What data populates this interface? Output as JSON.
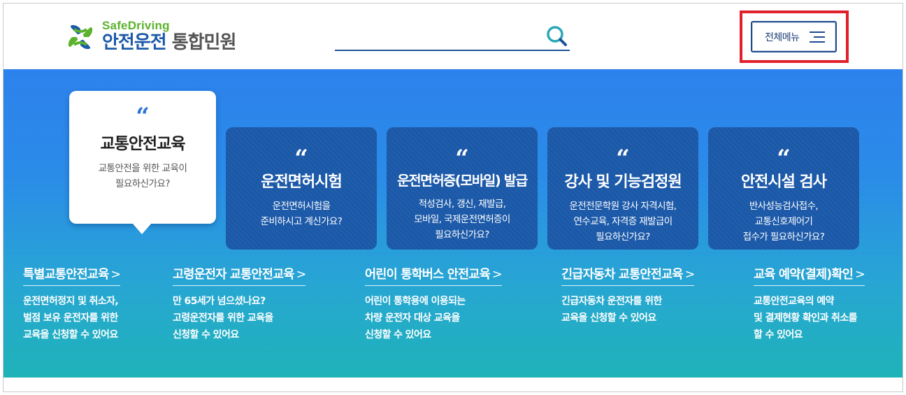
{
  "logo": {
    "english": "SafeDriving",
    "korean_primary": "안전운전",
    "korean_secondary": "통합민원",
    "colors": {
      "green": "#5bb22c",
      "blue": "#1c5aa8"
    }
  },
  "search": {
    "placeholder": "",
    "icon": "search-icon"
  },
  "menu": {
    "label": "전체메뉴",
    "icon": "hamburger-menu-icon"
  },
  "featured_card": {
    "quote": "“",
    "title": "교통안전교육",
    "desc_line1": "교통안전을 위한 교육이",
    "desc_line2": "필요하신가요?"
  },
  "cards": [
    {
      "quote": "“",
      "title": "운전면허시험",
      "lines": [
        "운전면허시험을",
        "준비하시고 계신가요?",
        ""
      ]
    },
    {
      "quote": "“",
      "title": "운전면허증(모바일) 발급",
      "lines": [
        "적성검사, 갱신, 재발급,",
        "모바일, 국제운전면허증이",
        "필요하신가요?"
      ]
    },
    {
      "quote": "“",
      "title": "강사 및 기능검정원",
      "lines": [
        "운전전문학원 강사 자격시험,",
        "연수교육, 자격증 재발급이",
        "필요하신가요?"
      ]
    },
    {
      "quote": "“",
      "title": "안전시설 검사",
      "lines": [
        "반사성능검사접수,",
        "교통신호제어기",
        "접수가 필요하신가요?"
      ]
    }
  ],
  "links": [
    {
      "title": "특별교통안전교육",
      "chevron": ">",
      "lines": [
        "운전면허정지 및 취소자,",
        "벌점 보유 운전자를 위한",
        "교육을 신청할 수 있어요"
      ]
    },
    {
      "title": "고령운전자 교통안전교육",
      "chevron": ">",
      "lines": [
        "만 65세가 넘으셨나요?",
        "고령운전자를 위한 교육을",
        "신청할 수 있어요"
      ]
    },
    {
      "title": "어린이 통학버스 안전교육",
      "chevron": ">",
      "lines": [
        "어린이 통학용에 이용되는",
        "차량 운전자 대상 교육을",
        "신청할 수 있어요"
      ]
    },
    {
      "title": "긴급자동차 교통안전교육",
      "chevron": ">",
      "lines": [
        "긴급자동차 운전자를 위한",
        "교육을 신청할 수 있어요",
        ""
      ]
    },
    {
      "title": "교육 예약(결제)확인",
      "chevron": ">",
      "lines": [
        "교통안전교육의 예약",
        "및 결제현황 확인과 취소를",
        "할 수 있어요"
      ]
    }
  ],
  "colors": {
    "hero_top": "#2c82ec",
    "hero_bottom": "#1fb3b8",
    "card_bg": "#1a58a8",
    "highlight_border": "#e0202a"
  }
}
